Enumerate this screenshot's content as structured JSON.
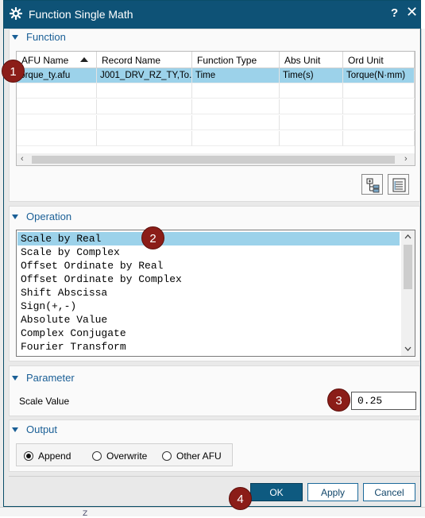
{
  "dialog": {
    "title": "Function Single Math",
    "help_label": "?",
    "close_label": "✕"
  },
  "function_section": {
    "header": "Function",
    "table": {
      "columns": [
        "AFU Name",
        "Record Name",
        "Function Type",
        "Abs Unit",
        "Ord Unit"
      ],
      "rows": [
        [
          "torque_ty.afu",
          "J001_DRV_RZ_TY,To...",
          "Time",
          "Time(s)",
          "Torque(N·mm)"
        ]
      ]
    }
  },
  "operation_section": {
    "header": "Operation",
    "items": [
      "Scale by Real",
      "Scale by Complex",
      "Offset Ordinate by Real",
      "Offset Ordinate by Complex",
      "Shift Abscissa",
      "Sign(+,-)",
      "Absolute Value",
      "Complex Conjugate",
      "Fourier Transform"
    ],
    "selected": "Scale by Real"
  },
  "parameter_section": {
    "header": "Parameter",
    "scale_label": "Scale Value",
    "scale_value": "0.25"
  },
  "output_section": {
    "header": "Output",
    "options": [
      "Append",
      "Overwrite",
      "Other AFU"
    ],
    "selected": "Append"
  },
  "buttons": {
    "ok": "OK",
    "apply": "Apply",
    "cancel": "Cancel"
  },
  "callouts": [
    "1",
    "2",
    "3",
    "4"
  ],
  "background": {
    "bottom_glyph": "Z"
  },
  "colors": {
    "titlebar": "#0e5276",
    "selection": "#9cd2ea",
    "section_header": "#1a5f96",
    "callout": "#8b1d18",
    "ok_button": "#0e5a80"
  },
  "icons": {
    "title": "gear-icon",
    "tool_buttons": [
      "expand-tree-icon",
      "list-details-icon"
    ]
  }
}
